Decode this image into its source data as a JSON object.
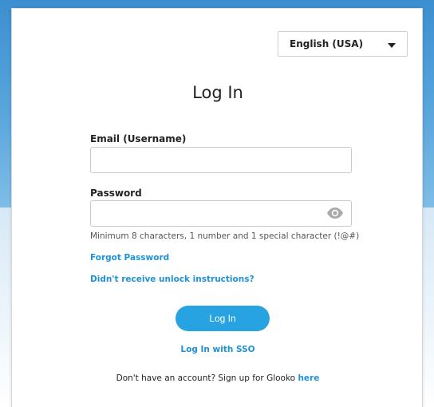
{
  "language": {
    "selected": "English (USA)"
  },
  "title": "Log In",
  "email": {
    "label": "Email (Username)",
    "value": "",
    "placeholder": ""
  },
  "password": {
    "label": "Password",
    "value": "",
    "placeholder": "",
    "hint": "Minimum 8 characters, 1 number and 1 special character (!@#)",
    "toggle_icon": "eye-icon"
  },
  "links": {
    "forgot_password": "Forgot Password",
    "unlock_instructions": "Didn't receive unlock instructions?",
    "sso": "Log In with SSO"
  },
  "buttons": {
    "login": "Log In"
  },
  "signup": {
    "text": "Don't have an account? Sign up for Glooko ",
    "link": "here"
  },
  "colors": {
    "accent": "#27a3e2",
    "link": "#1e92d6"
  }
}
